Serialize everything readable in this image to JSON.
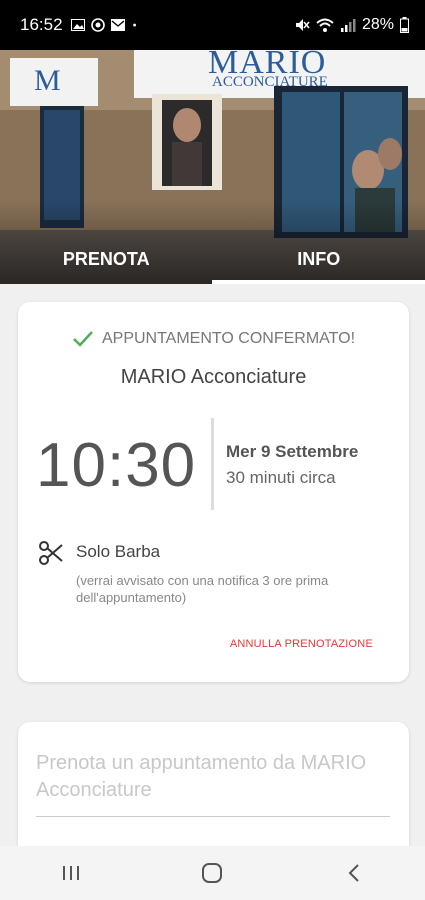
{
  "status_bar": {
    "time": "16:52",
    "battery": "28%",
    "left_icons": [
      "image-icon",
      "whatsapp-icon",
      "mail-icon",
      "dot-icon"
    ],
    "right_icons": [
      "mute-icon",
      "wifi-icon",
      "signal-icon",
      "battery-icon"
    ]
  },
  "hero": {
    "sign_logo": "M",
    "sign_name": "MARIO",
    "sign_sub": "ACCONCIATURE"
  },
  "tabs": [
    {
      "label": "PRENOTA",
      "active": true
    },
    {
      "label": "INFO",
      "active": false
    }
  ],
  "appointment": {
    "status": "APPUNTAMENTO CONFERMATO!",
    "shop_name": "MARIO Acconciature",
    "time": "10:30",
    "date": "Mer 9 Settembre",
    "duration": "30 minuti circa",
    "service": "Solo Barba",
    "notice": "(verrai avvisato con una notifica 3 ore prima dell'appuntamento)",
    "cancel_label": "ANNULLA PRENOTAZIONE"
  },
  "booking": {
    "prompt": "Prenota un appuntamento da MARIO Acconciature"
  },
  "colors": {
    "confirm_green": "#4caf50",
    "cancel_red": "#e53935"
  }
}
